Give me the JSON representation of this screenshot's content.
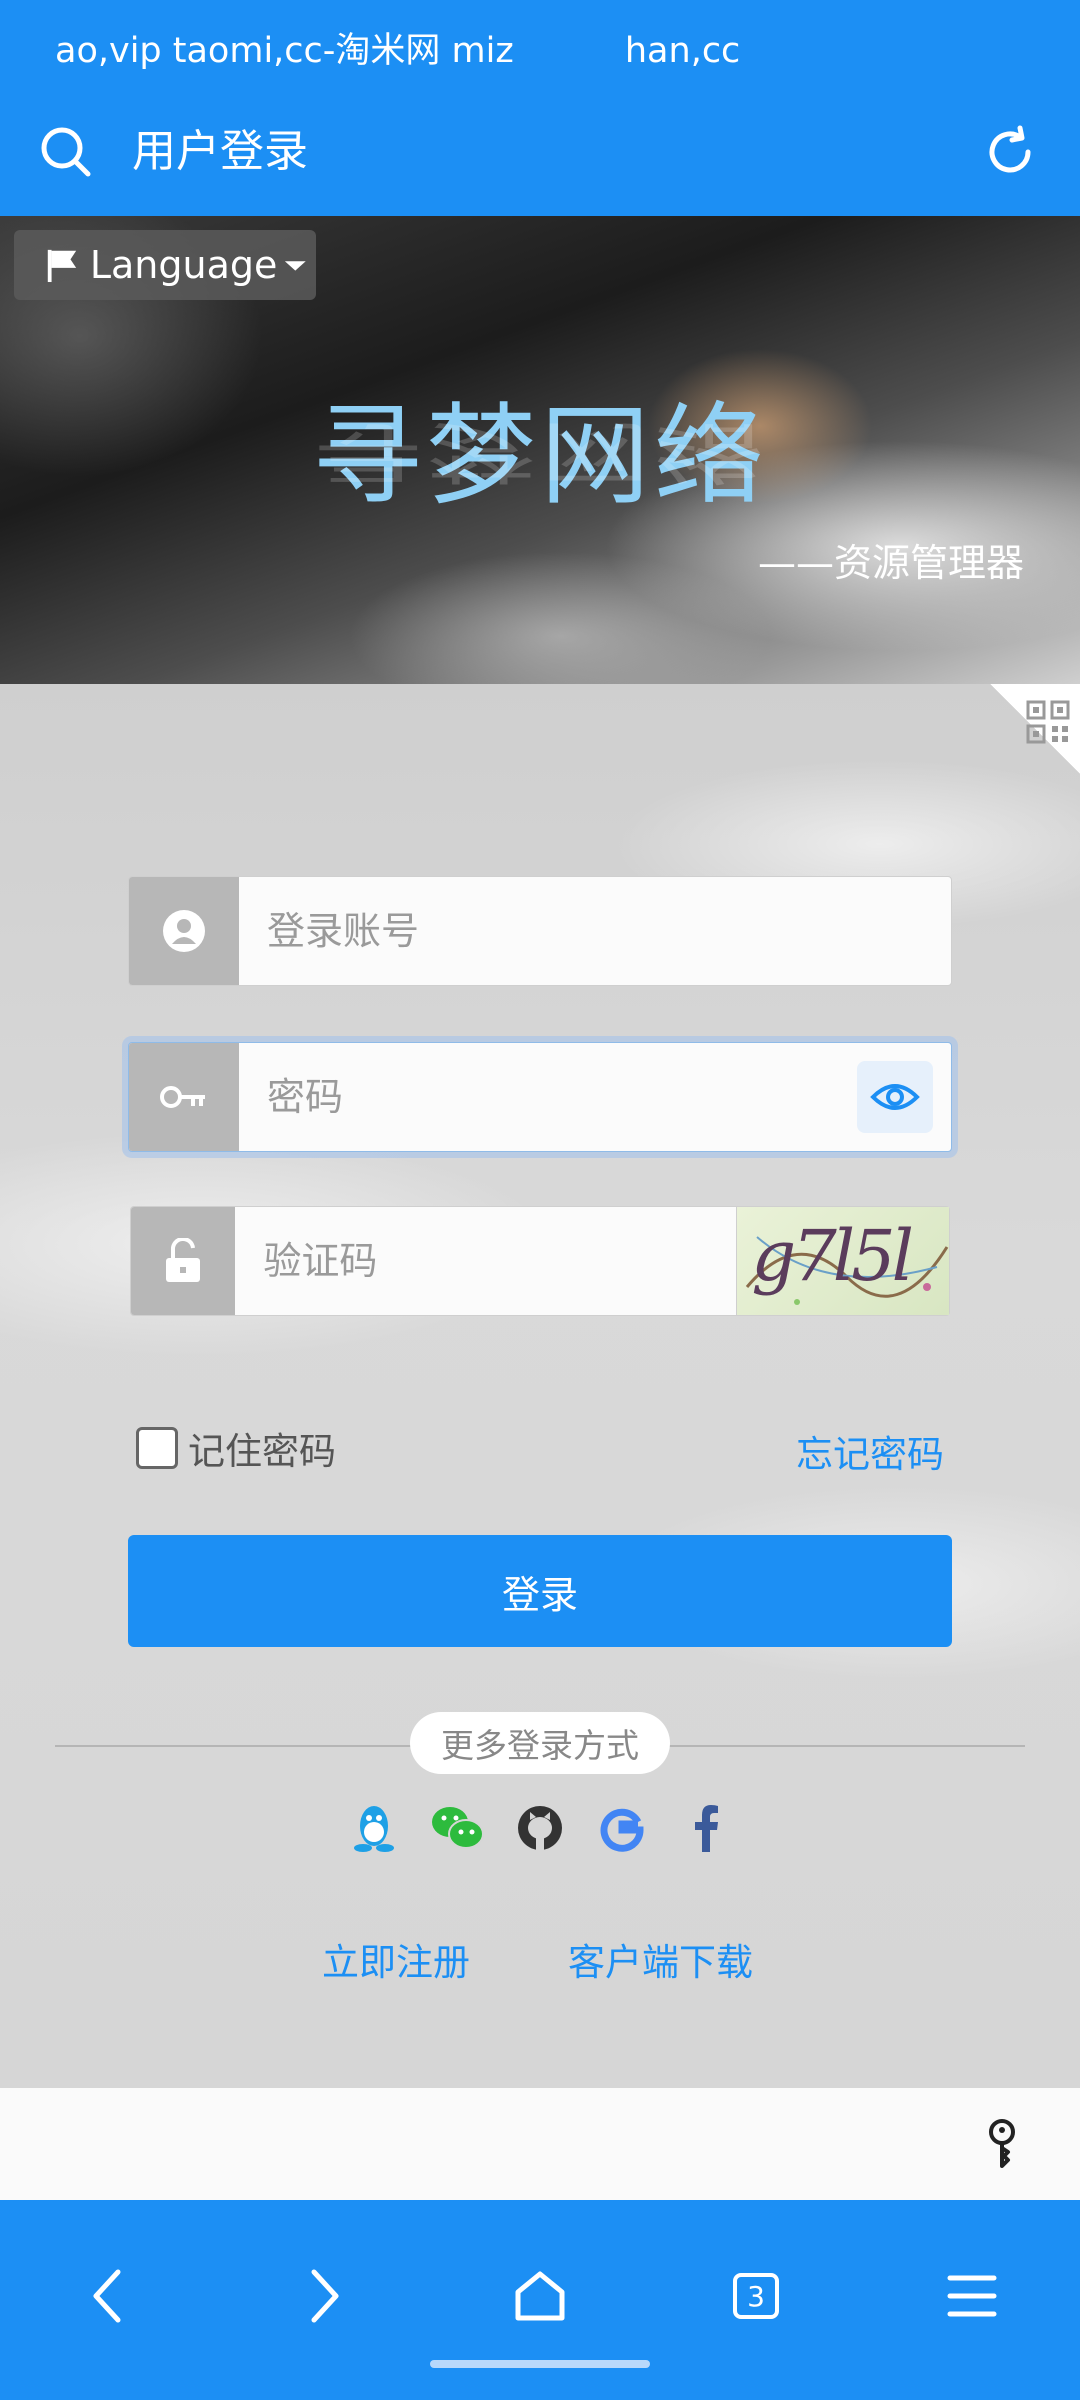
{
  "ticker": {
    "items": [
      "ao,vip taomi,cc-淘米网 miz",
      "han,cc"
    ]
  },
  "header": {
    "title": "用户登录",
    "search_icon": "search-icon",
    "refresh_icon": "refresh-icon"
  },
  "hero": {
    "language_label": "Language",
    "brand": "寻梦网络",
    "subtitle": "——资源管理器"
  },
  "form": {
    "account_placeholder": "登录账号",
    "password_placeholder": "密码",
    "captcha_placeholder": "验证码",
    "captcha_image_text": "g7l5l",
    "remember_label": "记住密码",
    "forgot_label": "忘记密码",
    "login_label": "登录"
  },
  "more_login": {
    "label": "更多登录方式",
    "providers": [
      "qq-icon",
      "wechat-icon",
      "github-icon",
      "google-icon",
      "facebook-icon"
    ]
  },
  "links": {
    "register": "立即注册",
    "download": "客户端下载"
  },
  "nav": {
    "tabs_count": "3"
  },
  "colors": {
    "primary": "#1c8ff4",
    "brand_text": "#8fd0f5"
  }
}
